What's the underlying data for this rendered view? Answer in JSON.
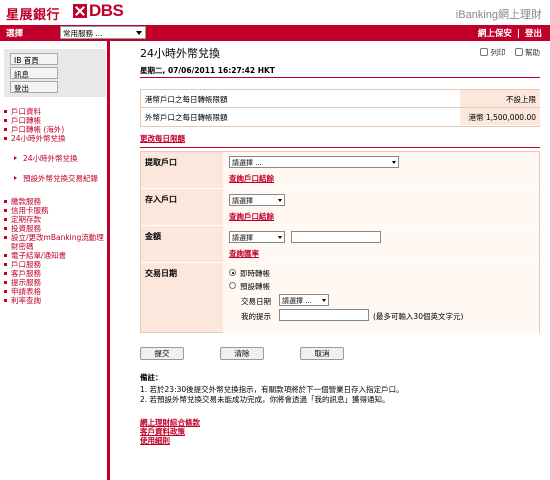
{
  "header": {
    "logo_zh": "星展銀行",
    "logo_dbs": "DBS",
    "brand_right": "iBanking網上理財",
    "bar_title": "選擇",
    "common_services": "常用服務 ...",
    "links": [
      "網上保安",
      "|",
      "登出"
    ]
  },
  "sidebar": {
    "top_buttons": [
      "IB 首頁",
      "訊息",
      "登出"
    ],
    "group1": [
      "戶口資料",
      "戶口轉帳",
      "戶口轉帳 (海外)",
      "24小時外幣兌換"
    ],
    "sub_items": [
      "24小時外幣兌換",
      "預設外幣兌換交易紀錄"
    ],
    "group2": [
      "繳款服務",
      "信用卡服務",
      "定期存款",
      "投資服務",
      "設立/更改mBanking流動理財密碼",
      "電子結單/通知書",
      "戶口服務",
      "客戶服務",
      "提示服務",
      "申請表格",
      "利率查詢"
    ]
  },
  "main": {
    "title": "24小時外幣兌換",
    "print_label": "列印",
    "help_label": "幫助",
    "date": "星期二, 07/06/2011 16:27:42 HKT",
    "limits": [
      {
        "label": "港幣戶口之每日轉帳限額",
        "value": "不設上限"
      },
      {
        "label": "外幣戶口之每日轉帳限額",
        "value": "港幣 1,500,000.00"
      }
    ],
    "change_limit_link": "更改每日限額",
    "form": {
      "from_label": "提取戶口",
      "from_select": "請選擇 ...",
      "from_link": "查詢戶口結餘",
      "to_label": "存入戶口",
      "to_select": "請選擇",
      "to_link": "查詢戶口結餘",
      "amount_label": "金額",
      "amount_select": "請選擇",
      "amount_value": "",
      "rate_link": "查詢匯率",
      "date_label": "交易日期",
      "opt_immediate": "即時轉帳",
      "opt_scheduled": "預設轉帳",
      "trade_date_label": "交易日期",
      "trade_date_select": "請選擇 ...",
      "reminder_label": "我的提示",
      "reminder_value": "",
      "reminder_hint": "(最多可輸入30個英文字元)"
    },
    "buttons": {
      "submit": "提交",
      "clear": "清除",
      "cancel": "取消"
    },
    "notes": {
      "title": "備註：",
      "lines": [
        "1.  若於23:30後提交外幣兌換指示，有關款項將於下一個營業日存入指定戶口。",
        "2.  若預設外幣兌換交易未能成功完成，你將會透過「我的訊息」獲得通知。"
      ]
    },
    "footer_links": [
      "網上理財綜合條款",
      "客戶資料政策",
      "使用細則"
    ]
  },
  "colors": {
    "brand_red": "#c0002a",
    "form_bg": "#fbe7db"
  }
}
